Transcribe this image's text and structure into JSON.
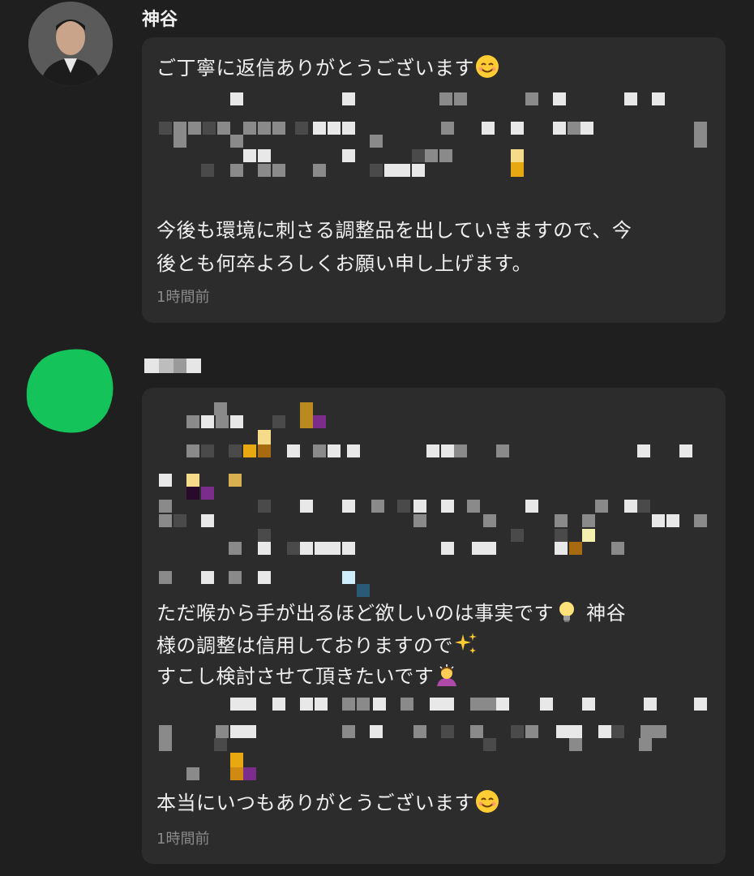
{
  "messages": [
    {
      "author": "神谷",
      "lines": [
        "ご丁寧に返信ありがとうございます",
        "今後も環境に刺さる調整品を出していきますので、今",
        "後とも何卒よろしくお願い申し上げます。"
      ],
      "time": "1時間前"
    },
    {
      "author": "",
      "lines": [
        "ただ喉から手が出るほど欲しいのは事実です",
        "神谷",
        "様の調整は信用しておりますので",
        "すこし検討させて頂きたいです",
        "本当にいつもありがとうございます"
      ],
      "time": "1時間前"
    }
  ],
  "colors": {
    "background": "#1f1f1f",
    "bubble": "#2c2c2c",
    "timestamp": "#8a8a8a",
    "avatar_green": "#14c45a"
  },
  "icons": [
    "smile-emoji-icon",
    "lightbulb-emoji-icon",
    "sparkles-emoji-icon",
    "bowing-person-emoji-icon"
  ]
}
